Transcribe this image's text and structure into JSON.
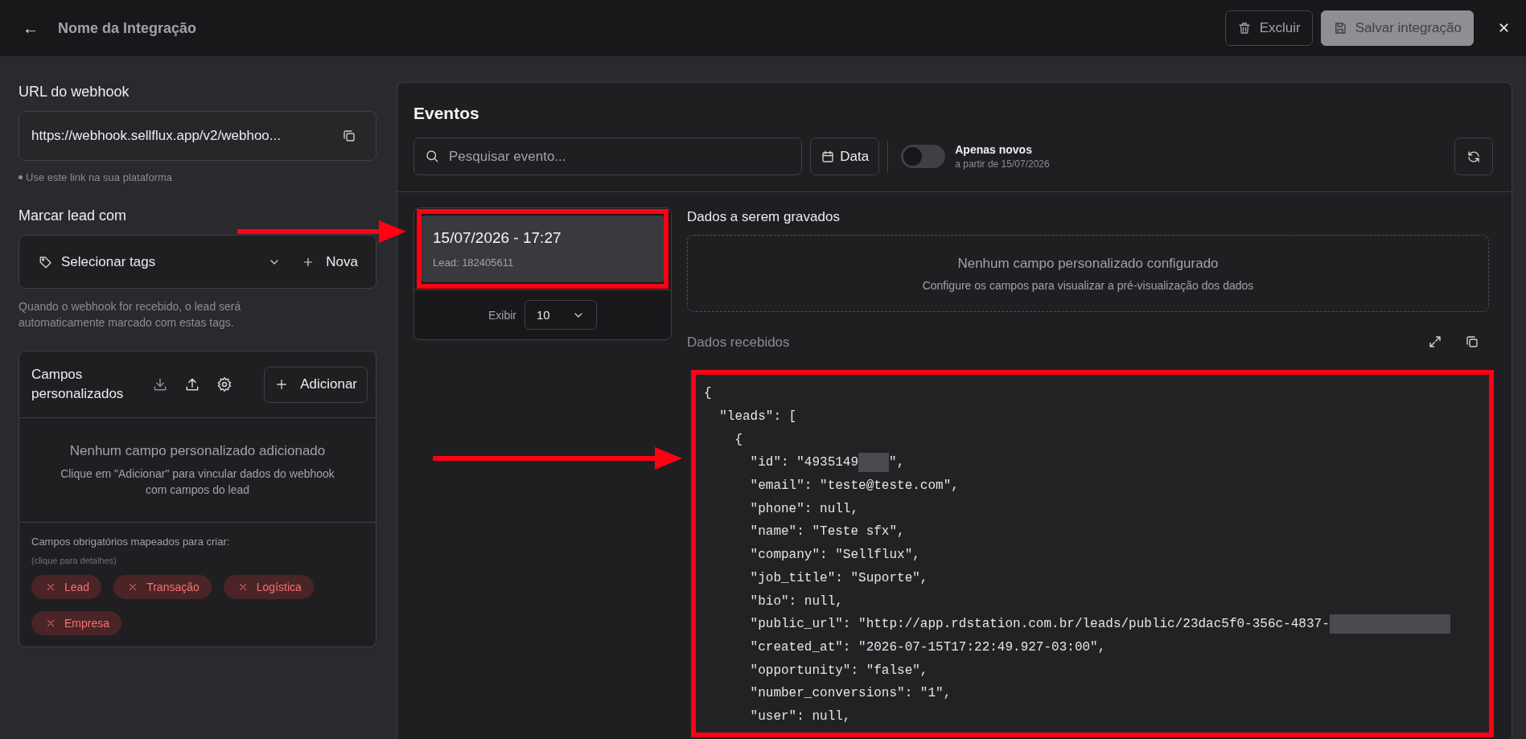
{
  "header": {
    "back": "←",
    "title": "Nome da Integração",
    "buttons": [
      {
        "kind": "delete",
        "label": "Excluir",
        "disabled": false
      },
      {
        "kind": "save",
        "label": "Salvar integração",
        "disabled": true
      }
    ],
    "close": "✕"
  },
  "webhook": {
    "label": "URL do webhook",
    "url": "https://webhook.sellflux.app/v2/webhoo...",
    "hint": "Use este link na sua plataforma"
  },
  "tags": {
    "label": "Marcar lead com",
    "placeholder": "Selecionar tags",
    "new_label": "Nova",
    "description": "Quando o webhook for recebido, o lead será automaticamente marcado com estas tags."
  },
  "custom_fields": {
    "title": "Campos personalizados",
    "add_label": "Adicionar",
    "empty_title": "Nenhum campo personalizado adicionado",
    "empty_text": "Clique em \"Adicionar\" para vincular dados do webhook com campos do lead",
    "required_label": "Campos obrigatórios mapeados para criar:",
    "required_hint": "(clique para detalhes)",
    "required": [
      {
        "label": "Lead",
        "mapped": false
      },
      {
        "label": "Transação",
        "mapped": false
      },
      {
        "label": "Logística",
        "mapped": false
      },
      {
        "label": "Empresa",
        "mapped": false
      }
    ]
  },
  "events": {
    "title": "Eventos",
    "search_placeholder": "Pesquisar evento...",
    "date_label": "Data",
    "only_new": {
      "label": "Apenas novos",
      "sub": "a partir de 15/07/2026",
      "on": false
    },
    "items": [
      {
        "title": "15/07/2026 - 17:27",
        "lead": "Lead: 182405611",
        "selected": true
      }
    ],
    "page_size_label": "Exibir",
    "page_size": "10"
  },
  "saved_data": {
    "label": "Dados a serem gravados",
    "empty_title": "Nenhum campo personalizado configurado",
    "empty_text": "Configure os campos para visualizar a pré-visualização dos dados"
  },
  "received": {
    "label": "Dados recebidos",
    "lines": [
      {
        "text": "{"
      },
      {
        "text": "  \"leads\": ["
      },
      {
        "text": "    {"
      },
      {
        "text": "      \"id\": \"4935149",
        "redacted": true,
        "after": "\","
      },
      {
        "text": "      \"email\": \"teste@teste.com\","
      },
      {
        "text": "      \"phone\": null,"
      },
      {
        "text": "      \"name\": \"Teste sfx\","
      },
      {
        "text": "      \"company\": \"Sellflux\","
      },
      {
        "text": "      \"job_title\": \"Suporte\","
      },
      {
        "text": "      \"bio\": null,"
      },
      {
        "text": "      \"public_url\": \"http://app.rdstation.com.br/leads/public/23dac5f0-356c-4837-",
        "redacted": true
      },
      {
        "text": "      \"created_at\": \"2026-07-15T17:22:49.927-03:00\","
      },
      {
        "text": "      \"opportunity\": \"false\","
      },
      {
        "text": "      \"number_conversions\": \"1\","
      },
      {
        "text": "      \"user\": null,"
      }
    ]
  }
}
